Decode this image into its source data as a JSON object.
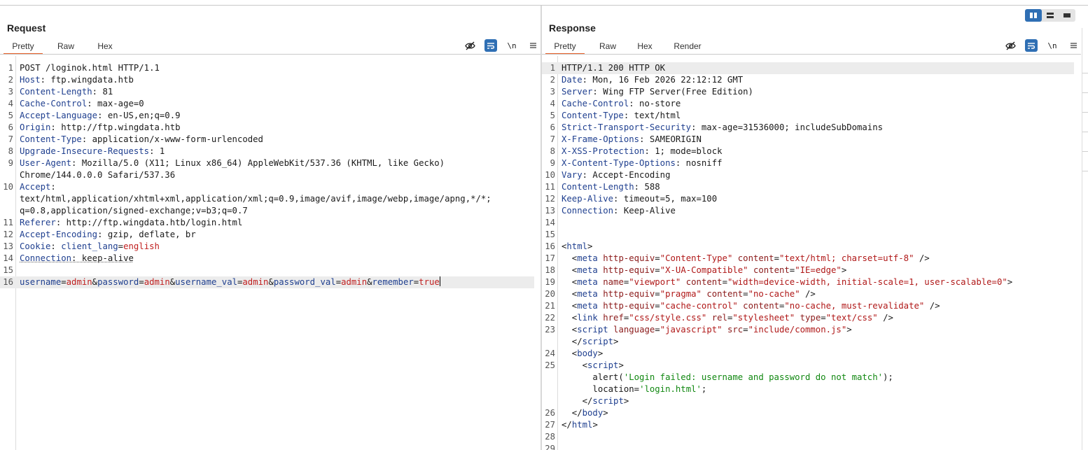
{
  "layout_toggle": {
    "options": [
      "side-by-side",
      "stacked",
      "single"
    ],
    "active": "side-by-side"
  },
  "request": {
    "title": "Request",
    "tabs": [
      "Pretty",
      "Raw",
      "Hex"
    ],
    "active_tab": "Pretty",
    "tools": {
      "hide": "eye-slash-icon",
      "wrap": "wrap-icon",
      "newline": "\\n",
      "menu": "menu-icon"
    }
  },
  "response": {
    "title": "Response",
    "tabs": [
      "Pretty",
      "Raw",
      "Hex",
      "Render"
    ],
    "active_tab": "Pretty",
    "tools": {
      "hide": "eye-slash-icon",
      "wrap": "wrap-icon",
      "newline": "\\n",
      "menu": "menu-icon"
    }
  },
  "request_lines": [
    {
      "n": "1",
      "parts": [
        [
          "",
          "POST /loginok.html HTTP/1.1"
        ]
      ]
    },
    {
      "n": "2",
      "parts": [
        [
          "hk",
          "Host"
        ],
        [
          "",
          ": ftp.wingdata.htb"
        ]
      ]
    },
    {
      "n": "3",
      "parts": [
        [
          "hk",
          "Content-Length"
        ],
        [
          "",
          ": 81"
        ]
      ]
    },
    {
      "n": "4",
      "parts": [
        [
          "hk",
          "Cache-Control"
        ],
        [
          "",
          ": max-age=0"
        ]
      ]
    },
    {
      "n": "5",
      "parts": [
        [
          "hk",
          "Accept-Language"
        ],
        [
          "",
          ": en-US,en;q=0.9"
        ]
      ]
    },
    {
      "n": "6",
      "parts": [
        [
          "hk",
          "Origin"
        ],
        [
          "",
          ": http://ftp.wingdata.htb"
        ]
      ]
    },
    {
      "n": "7",
      "parts": [
        [
          "hk",
          "Content-Type"
        ],
        [
          "",
          ": application/x-www-form-urlencoded"
        ]
      ]
    },
    {
      "n": "8",
      "parts": [
        [
          "hk",
          "Upgrade-Insecure-Requests"
        ],
        [
          "",
          ": 1"
        ]
      ]
    },
    {
      "n": "9",
      "parts": [
        [
          "hk",
          "User-Agent"
        ],
        [
          "",
          ": Mozilla/5.0 (X11; Linux x86_64) AppleWebKit/537.36 (KHTML, like Gecko)"
        ]
      ]
    },
    {
      "n": "",
      "parts": [
        [
          "",
          "Chrome/144.0.0.0 Safari/537.36"
        ]
      ]
    },
    {
      "n": "10",
      "parts": [
        [
          "hk",
          "Accept"
        ],
        [
          "",
          ":"
        ]
      ]
    },
    {
      "n": "",
      "parts": [
        [
          "",
          "text/html,application/xhtml+xml,application/xml;q=0.9,image/avif,image/webp,image/apng,*/*;"
        ]
      ]
    },
    {
      "n": "",
      "parts": [
        [
          "",
          "q=0.8,application/signed-exchange;v=b3;q=0.7"
        ]
      ]
    },
    {
      "n": "11",
      "parts": [
        [
          "hk",
          "Referer"
        ],
        [
          "",
          ": http://ftp.wingdata.htb/login.html"
        ]
      ]
    },
    {
      "n": "12",
      "parts": [
        [
          "hk",
          "Accept-Encoding"
        ],
        [
          "",
          ": gzip, deflate, br"
        ]
      ]
    },
    {
      "n": "13",
      "parts": [
        [
          "hk",
          "Cookie"
        ],
        [
          "",
          ": "
        ],
        [
          "pk",
          "client_lang"
        ],
        [
          "",
          "="
        ],
        [
          "pv",
          "english"
        ]
      ]
    },
    {
      "n": "14",
      "parts": [
        [
          "hk under",
          "Connection"
        ],
        [
          "under",
          ": keep-alive"
        ]
      ]
    },
    {
      "n": "15",
      "parts": []
    },
    {
      "n": "16",
      "hl": true,
      "cursor": true,
      "parts": [
        [
          "pk",
          "username"
        ],
        [
          "",
          "="
        ],
        [
          "pv",
          "admin"
        ],
        [
          "",
          "&"
        ],
        [
          "pk",
          "password"
        ],
        [
          "",
          "="
        ],
        [
          "pv",
          "admin"
        ],
        [
          "",
          "&"
        ],
        [
          "pk",
          "username_val"
        ],
        [
          "",
          "="
        ],
        [
          "pv",
          "admin"
        ],
        [
          "",
          "&"
        ],
        [
          "pk",
          "password_val"
        ],
        [
          "",
          "="
        ],
        [
          "pv",
          "admin"
        ],
        [
          "",
          "&"
        ],
        [
          "pk",
          "remember"
        ],
        [
          "",
          "="
        ],
        [
          "pv",
          "true"
        ]
      ]
    }
  ],
  "response_lines": [
    {
      "n": "1",
      "hl": true,
      "parts": [
        [
          "",
          "HTTP/1.1 200 HTTP OK"
        ]
      ]
    },
    {
      "n": "2",
      "parts": [
        [
          "hk",
          "Date"
        ],
        [
          "",
          ": Mon, 16 Feb 2026 22:12:12 GMT"
        ]
      ]
    },
    {
      "n": "3",
      "parts": [
        [
          "hk",
          "Server"
        ],
        [
          "",
          ": Wing FTP Server(Free Edition)"
        ]
      ]
    },
    {
      "n": "4",
      "parts": [
        [
          "hk",
          "Cache-Control"
        ],
        [
          "",
          ": no-store"
        ]
      ]
    },
    {
      "n": "5",
      "parts": [
        [
          "hk",
          "Content-Type"
        ],
        [
          "",
          ": text/html"
        ]
      ]
    },
    {
      "n": "6",
      "parts": [
        [
          "hk",
          "Strict-Transport-Security"
        ],
        [
          "",
          ": max-age=31536000; includeSubDomains"
        ]
      ]
    },
    {
      "n": "7",
      "parts": [
        [
          "hk",
          "X-Frame-Options"
        ],
        [
          "",
          ": SAMEORIGIN"
        ]
      ]
    },
    {
      "n": "8",
      "parts": [
        [
          "hk",
          "X-XSS-Protection"
        ],
        [
          "",
          ": 1; mode=block"
        ]
      ]
    },
    {
      "n": "9",
      "parts": [
        [
          "hk",
          "X-Content-Type-Options"
        ],
        [
          "",
          ": nosniff"
        ]
      ]
    },
    {
      "n": "10",
      "parts": [
        [
          "hk",
          "Vary"
        ],
        [
          "",
          ": Accept-Encoding"
        ]
      ]
    },
    {
      "n": "11",
      "parts": [
        [
          "hk",
          "Content-Length"
        ],
        [
          "",
          ": 588"
        ]
      ]
    },
    {
      "n": "12",
      "parts": [
        [
          "hk",
          "Keep-Alive"
        ],
        [
          "",
          ": timeout=5, max=100"
        ]
      ]
    },
    {
      "n": "13",
      "parts": [
        [
          "hk",
          "Connection"
        ],
        [
          "",
          ": Keep-Alive"
        ]
      ]
    },
    {
      "n": "14",
      "parts": []
    },
    {
      "n": "15",
      "parts": []
    },
    {
      "n": "16",
      "parts": [
        [
          "",
          "<"
        ],
        [
          "tg",
          "html"
        ],
        [
          "",
          ">"
        ]
      ]
    },
    {
      "n": "17",
      "parts": [
        [
          "",
          "  <"
        ],
        [
          "tg",
          "meta"
        ],
        [
          "",
          " "
        ],
        [
          "at",
          "http-equiv"
        ],
        [
          "",
          "="
        ],
        [
          "av",
          "\"Content-Type\""
        ],
        [
          "",
          " "
        ],
        [
          "at",
          "content"
        ],
        [
          "",
          "="
        ],
        [
          "av",
          "\"text/html; charset=utf-8\""
        ],
        [
          "",
          " />"
        ]
      ]
    },
    {
      "n": "18",
      "parts": [
        [
          "",
          "  <"
        ],
        [
          "tg",
          "meta"
        ],
        [
          "",
          " "
        ],
        [
          "at",
          "http-equiv"
        ],
        [
          "",
          "="
        ],
        [
          "av",
          "\"X-UA-Compatible\""
        ],
        [
          "",
          " "
        ],
        [
          "at",
          "content"
        ],
        [
          "",
          "="
        ],
        [
          "av",
          "\"IE=edge\""
        ],
        [
          "",
          ">"
        ]
      ]
    },
    {
      "n": "19",
      "parts": [
        [
          "",
          "  <"
        ],
        [
          "tg",
          "meta"
        ],
        [
          "",
          " "
        ],
        [
          "at",
          "name"
        ],
        [
          "",
          "="
        ],
        [
          "av",
          "\"viewport\""
        ],
        [
          "",
          " "
        ],
        [
          "at",
          "content"
        ],
        [
          "",
          "="
        ],
        [
          "av",
          "\"width=device-width, initial-scale=1, user-scalable=0\""
        ],
        [
          "",
          ">"
        ]
      ]
    },
    {
      "n": "20",
      "parts": [
        [
          "",
          "  <"
        ],
        [
          "tg",
          "meta"
        ],
        [
          "",
          " "
        ],
        [
          "at",
          "http-equiv"
        ],
        [
          "",
          "="
        ],
        [
          "av",
          "\"pragma\""
        ],
        [
          "",
          " "
        ],
        [
          "at",
          "content"
        ],
        [
          "",
          "="
        ],
        [
          "av",
          "\"no-cache\""
        ],
        [
          "",
          " />"
        ]
      ]
    },
    {
      "n": "21",
      "parts": [
        [
          "",
          "  <"
        ],
        [
          "tg",
          "meta"
        ],
        [
          "",
          " "
        ],
        [
          "at",
          "http-equiv"
        ],
        [
          "",
          "="
        ],
        [
          "av",
          "\"cache-control\""
        ],
        [
          "",
          " "
        ],
        [
          "at",
          "content"
        ],
        [
          "",
          "="
        ],
        [
          "av",
          "\"no-cache, must-revalidate\""
        ],
        [
          "",
          " />"
        ]
      ]
    },
    {
      "n": "22",
      "parts": [
        [
          "",
          "  <"
        ],
        [
          "tg",
          "link"
        ],
        [
          "",
          " "
        ],
        [
          "at",
          "href"
        ],
        [
          "",
          "="
        ],
        [
          "av",
          "\"css/style.css\""
        ],
        [
          "",
          " "
        ],
        [
          "at",
          "rel"
        ],
        [
          "",
          "="
        ],
        [
          "av",
          "\"stylesheet\""
        ],
        [
          "",
          " "
        ],
        [
          "at",
          "type"
        ],
        [
          "",
          "="
        ],
        [
          "av",
          "\"text/css\""
        ],
        [
          "",
          " />"
        ]
      ]
    },
    {
      "n": "23",
      "parts": [
        [
          "",
          "  <"
        ],
        [
          "tg",
          "script"
        ],
        [
          "",
          " "
        ],
        [
          "at",
          "language"
        ],
        [
          "",
          "="
        ],
        [
          "av",
          "\"javascript\""
        ],
        [
          "",
          " "
        ],
        [
          "at",
          "src"
        ],
        [
          "",
          "="
        ],
        [
          "av",
          "\"include/common.js\""
        ],
        [
          "",
          ">"
        ]
      ]
    },
    {
      "n": "",
      "parts": [
        [
          "",
          "  </"
        ],
        [
          "tg",
          "script"
        ],
        [
          "",
          ">"
        ]
      ]
    },
    {
      "n": "24",
      "parts": [
        [
          "",
          "  <"
        ],
        [
          "tg",
          "body"
        ],
        [
          "",
          ">"
        ]
      ]
    },
    {
      "n": "25",
      "parts": [
        [
          "",
          "    <"
        ],
        [
          "tg",
          "script"
        ],
        [
          "",
          ">"
        ]
      ]
    },
    {
      "n": "",
      "parts": [
        [
          "",
          "      alert("
        ],
        [
          "js",
          "'Login failed: username and password do not match'"
        ],
        [
          "",
          ");"
        ]
      ]
    },
    {
      "n": "",
      "parts": [
        [
          "",
          "      location="
        ],
        [
          "js",
          "'login.html'"
        ],
        [
          "",
          ";"
        ]
      ]
    },
    {
      "n": "",
      "parts": [
        [
          "",
          "    </"
        ],
        [
          "tg",
          "script"
        ],
        [
          "",
          ">"
        ]
      ]
    },
    {
      "n": "26",
      "parts": [
        [
          "",
          "  </"
        ],
        [
          "tg",
          "body"
        ],
        [
          "",
          ">"
        ]
      ]
    },
    {
      "n": "27",
      "parts": [
        [
          "",
          "</"
        ],
        [
          "tg",
          "html"
        ],
        [
          "",
          ">"
        ]
      ]
    },
    {
      "n": "28",
      "parts": []
    },
    {
      "n": "29",
      "parts": []
    }
  ]
}
